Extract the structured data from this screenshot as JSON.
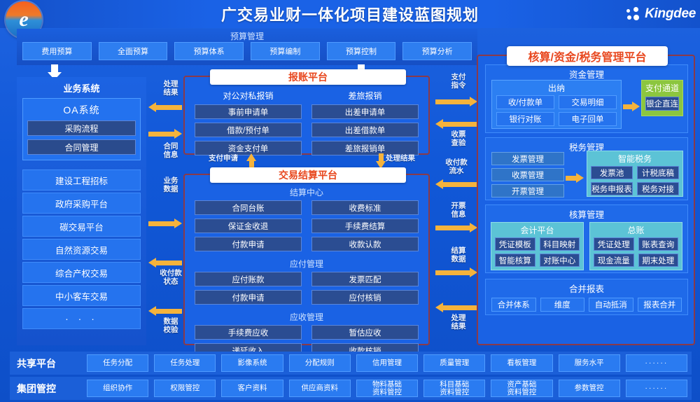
{
  "header": {
    "title": "广交易业财一体化项目建设蓝图规划",
    "logo_icon": "e-circle-logo",
    "brand": "Kingdee",
    "brand_icon": "kingdee-dots-icon"
  },
  "budget": {
    "title": "预算管理",
    "items": [
      "费用预算",
      "全面预算",
      "预算体系",
      "预算编制",
      "预算控制",
      "预算分析"
    ]
  },
  "business": {
    "title": "业务系统",
    "oa": {
      "title": "OA系统",
      "items": [
        "采购流程",
        "合同管理"
      ]
    },
    "platforms": [
      "建设工程招标",
      "政府采购平台",
      "碳交易平台",
      "自然资源交易",
      "综合产权交易",
      "中小客车交易",
      "· · ·"
    ]
  },
  "flows": {
    "left": [
      {
        "label": "处理\n结果",
        "dir": "left"
      },
      {
        "label": "合同\n信息",
        "dir": "right"
      },
      {
        "label": "业务\n数据",
        "dir": "right"
      },
      {
        "label": "收付款\n状态",
        "dir": "left"
      },
      {
        "label": "数据\n校验",
        "dir": "left"
      }
    ],
    "left_labels": [
      "处理结果",
      "合同信息",
      "业务数据",
      "收付款状态",
      "数据校验"
    ],
    "mid_up": "支付申请",
    "mid_down": "处理结果",
    "right_labels": [
      "支付指令",
      "收票查验",
      "收付款流水",
      "开票信息",
      "结算数据",
      "处理结果"
    ]
  },
  "reimbursement": {
    "title": "报账平台",
    "columns": [
      {
        "title": "对公对私报销",
        "items": [
          "事前申请单",
          "借款/预付单",
          "资金支付单"
        ]
      },
      {
        "title": "差旅报销",
        "items": [
          "出差申请单",
          "出差借款单",
          "差旅报销单"
        ]
      }
    ]
  },
  "settlement": {
    "title": "交易结算平台",
    "groups": [
      {
        "title": "结算中心",
        "left": [
          "合同台账",
          "保证金收退",
          "付款申请"
        ],
        "right": [
          "收费标准",
          "手续费结算",
          "收款认款"
        ]
      },
      {
        "title": "应付管理",
        "left": [
          "应付账款",
          "付款申请"
        ],
        "right": [
          "发票匹配",
          "应付核销"
        ]
      },
      {
        "title": "应收管理",
        "left": [
          "手续费应收",
          "递延收入"
        ],
        "right": [
          "暂估应收",
          "收款核销"
        ]
      }
    ]
  },
  "platform": {
    "title": "核算/资金/税务管理平台",
    "fund": {
      "title": "资金管理",
      "cashier": {
        "title": "出纳",
        "items": [
          "收/付款单",
          "交易明细",
          "银行对账",
          "电子回单"
        ]
      },
      "channel": {
        "title": "支付通道",
        "items": [
          "银企直连"
        ]
      }
    },
    "tax": {
      "title": "税务管理",
      "left": [
        "发票管理",
        "收票管理",
        "开票管理"
      ],
      "smart": {
        "title": "智能税务",
        "items": [
          "发票池",
          "计税底稿",
          "税务申报表",
          "税务对接"
        ]
      }
    },
    "accounting": {
      "title": "核算管理",
      "groups": [
        {
          "title": "会计平台",
          "items": [
            "凭证模板",
            "科目映射",
            "智能核算",
            "对账中心"
          ]
        },
        {
          "title": "总账",
          "items": [
            "凭证处理",
            "账表查询",
            "现金流量",
            "期末处理"
          ]
        }
      ]
    },
    "consolidation": {
      "title": "合并报表",
      "items": [
        "合并体系",
        "维度",
        "自动抵消",
        "报表合并"
      ]
    }
  },
  "bottom": {
    "share": {
      "label": "共享平台",
      "items": [
        "任务分配",
        "任务处理",
        "影像系统",
        "分配规则",
        "信用管理",
        "质量管理",
        "看板管理",
        "服务水平",
        "······"
      ]
    },
    "group": {
      "label": "集团管控",
      "items": [
        "组织协作",
        "权限管控",
        "客户资料",
        "供应商资料",
        "物料基础\n资料管控",
        "科目基础\n资料管控",
        "资产基础\n资料管控",
        "参数管控",
        "······"
      ]
    }
  },
  "colors": {
    "accent_red": "#e8481f",
    "arrow": "#f5b33c",
    "panel_border": "#8a3a4a",
    "green": "#8cc63f",
    "teal": "#5cc3d6"
  }
}
